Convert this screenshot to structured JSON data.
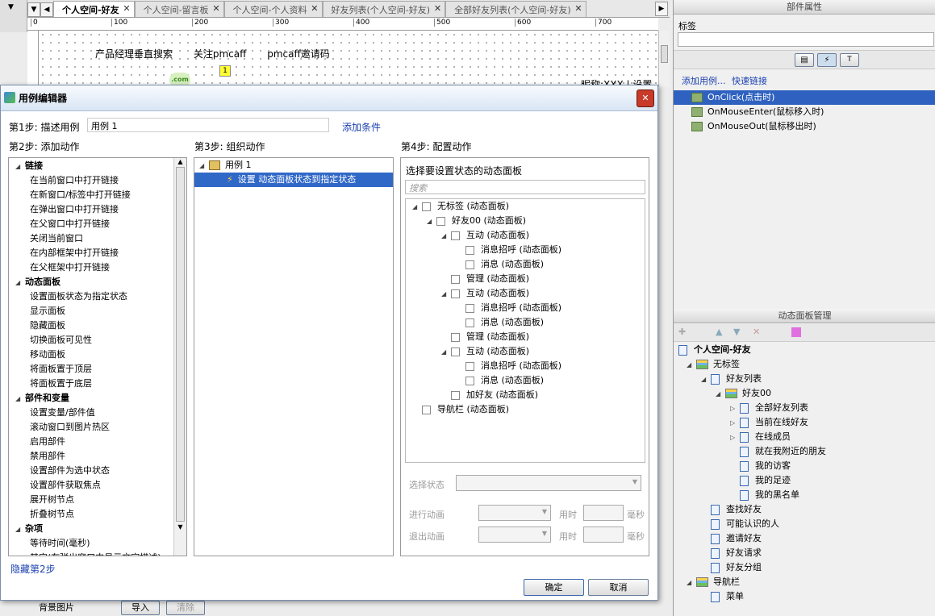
{
  "tabs": [
    "个人空间-好友",
    "个人空间-留言板",
    "个人空间-个人资料",
    "好友列表(个人空间-好友)",
    "全部好友列表(个人空间-好友)"
  ],
  "ruler_ticks": [
    "0",
    "100",
    "200",
    "300",
    "400",
    "500",
    "600",
    "700"
  ],
  "canvas": {
    "nav": [
      "产品经理垂直搜索",
      "关注pmcaff",
      "pmcaff邀请码"
    ],
    "com": ".com",
    "badge": "1",
    "nickname": "昵称:XXX",
    "settings": "设置"
  },
  "props": {
    "header": "部件属性",
    "label_caption": "标签",
    "label_value": "",
    "add_case": "添加用例...",
    "quick_link": "快速链接",
    "events": [
      "OnClick(点击时)",
      "OnMouseEnter(鼠标移入时)",
      "OnMouseOut(鼠标移出时)"
    ]
  },
  "dpm": {
    "header": "动态面板管理",
    "tree": [
      {
        "level": 0,
        "type": "page",
        "label": "个人空间-好友",
        "bold": true
      },
      {
        "level": 1,
        "type": "dp",
        "label": "无标签",
        "arrow": "◢"
      },
      {
        "level": 2,
        "type": "state",
        "label": "好友列表",
        "arrow": "◢"
      },
      {
        "level": 3,
        "type": "dp",
        "label": "好友00",
        "arrow": "◢"
      },
      {
        "level": 4,
        "type": "state",
        "label": "全部好友列表",
        "arrow": "▷"
      },
      {
        "level": 4,
        "type": "state",
        "label": "当前在线好友",
        "arrow": "▷"
      },
      {
        "level": 4,
        "type": "state",
        "label": "在线成员",
        "arrow": "▷"
      },
      {
        "level": 4,
        "type": "state",
        "label": "就在我附近的朋友",
        "arrow": ""
      },
      {
        "level": 4,
        "type": "state",
        "label": "我的访客",
        "arrow": ""
      },
      {
        "level": 4,
        "type": "state",
        "label": "我的足迹",
        "arrow": ""
      },
      {
        "level": 4,
        "type": "state",
        "label": "我的黑名单",
        "arrow": ""
      },
      {
        "level": 2,
        "type": "state",
        "label": "查找好友",
        "arrow": ""
      },
      {
        "level": 2,
        "type": "state",
        "label": "可能认识的人",
        "arrow": ""
      },
      {
        "level": 2,
        "type": "state",
        "label": "邀请好友",
        "arrow": ""
      },
      {
        "level": 2,
        "type": "state",
        "label": "好友请求",
        "arrow": ""
      },
      {
        "level": 2,
        "type": "state",
        "label": "好友分组",
        "arrow": ""
      },
      {
        "level": 1,
        "type": "dp",
        "label": "导航栏",
        "arrow": "◢"
      },
      {
        "level": 2,
        "type": "state",
        "label": "菜单",
        "arrow": ""
      }
    ]
  },
  "dialog": {
    "title": "用例编辑器",
    "step1": "第1步: 描述用例",
    "case_name": "用例 1",
    "add_condition": "添加条件",
    "step2": "第2步: 添加动作",
    "step3": "第3步: 组织动作",
    "step4": "第4步: 配置动作",
    "hide_step2": "隐藏第2步",
    "actions": [
      {
        "h": true,
        "t": "链接"
      },
      {
        "t": "在当前窗口中打开链接"
      },
      {
        "t": "在新窗口/标签中打开链接"
      },
      {
        "t": "在弹出窗口中打开链接"
      },
      {
        "t": "在父窗口中打开链接"
      },
      {
        "t": "关闭当前窗口"
      },
      {
        "t": "在内部框架中打开链接"
      },
      {
        "t": "在父框架中打开链接"
      },
      {
        "h": true,
        "t": "动态面板"
      },
      {
        "t": "设置面板状态为指定状态"
      },
      {
        "t": "显示面板"
      },
      {
        "t": "隐藏面板"
      },
      {
        "t": "切换面板可见性"
      },
      {
        "t": "移动面板"
      },
      {
        "t": "将面板置于顶层"
      },
      {
        "t": "将面板置于底层"
      },
      {
        "h": true,
        "t": "部件和变量"
      },
      {
        "t": "设置变量/部件值"
      },
      {
        "t": "滚动窗口到图片热区"
      },
      {
        "t": "启用部件"
      },
      {
        "t": "禁用部件"
      },
      {
        "t": "设置部件为选中状态"
      },
      {
        "t": "设置部件获取焦点"
      },
      {
        "t": "展开树节点"
      },
      {
        "t": "折叠树节点"
      },
      {
        "h": true,
        "t": "杂项"
      },
      {
        "t": "等待时间(毫秒)"
      },
      {
        "t": "其它(在弹出窗口中显示文字描述)"
      }
    ],
    "organize": {
      "case": "用例 1",
      "action": "设置 动态面板状态到指定状态"
    },
    "config": {
      "prompt": "选择要设置状态的动态面板",
      "search_placeholder": "搜索",
      "panels": [
        {
          "level": 0,
          "arrow": "◢",
          "label": "无标签 (动态面板)"
        },
        {
          "level": 1,
          "arrow": "◢",
          "label": "好友00 (动态面板)"
        },
        {
          "level": 2,
          "arrow": "◢",
          "label": "互动 (动态面板)"
        },
        {
          "level": 3,
          "arrow": "",
          "label": "消息招呼 (动态面板)"
        },
        {
          "level": 3,
          "arrow": "",
          "label": "消息 (动态面板)"
        },
        {
          "level": 2,
          "arrow": "",
          "label": "管理 (动态面板)"
        },
        {
          "level": 2,
          "arrow": "◢",
          "label": "互动 (动态面板)"
        },
        {
          "level": 3,
          "arrow": "",
          "label": "消息招呼 (动态面板)"
        },
        {
          "level": 3,
          "arrow": "",
          "label": "消息 (动态面板)"
        },
        {
          "level": 2,
          "arrow": "",
          "label": "管理 (动态面板)"
        },
        {
          "level": 2,
          "arrow": "◢",
          "label": "互动 (动态面板)"
        },
        {
          "level": 3,
          "arrow": "",
          "label": "消息招呼 (动态面板)"
        },
        {
          "level": 3,
          "arrow": "",
          "label": "消息 (动态面板)"
        },
        {
          "level": 2,
          "arrow": "",
          "label": "加好友 (动态面板)"
        },
        {
          "level": 0,
          "arrow": "",
          "label": "导航栏 (动态面板)"
        }
      ],
      "select_state": "选择状态",
      "enter_anim": "进行动画",
      "exit_anim": "退出动画",
      "duration": "用时",
      "ms": "毫秒"
    },
    "ok": "确定",
    "cancel": "取消"
  },
  "bottom": {
    "bg_image": "背景图片",
    "import": "导入",
    "clear": "清除"
  }
}
